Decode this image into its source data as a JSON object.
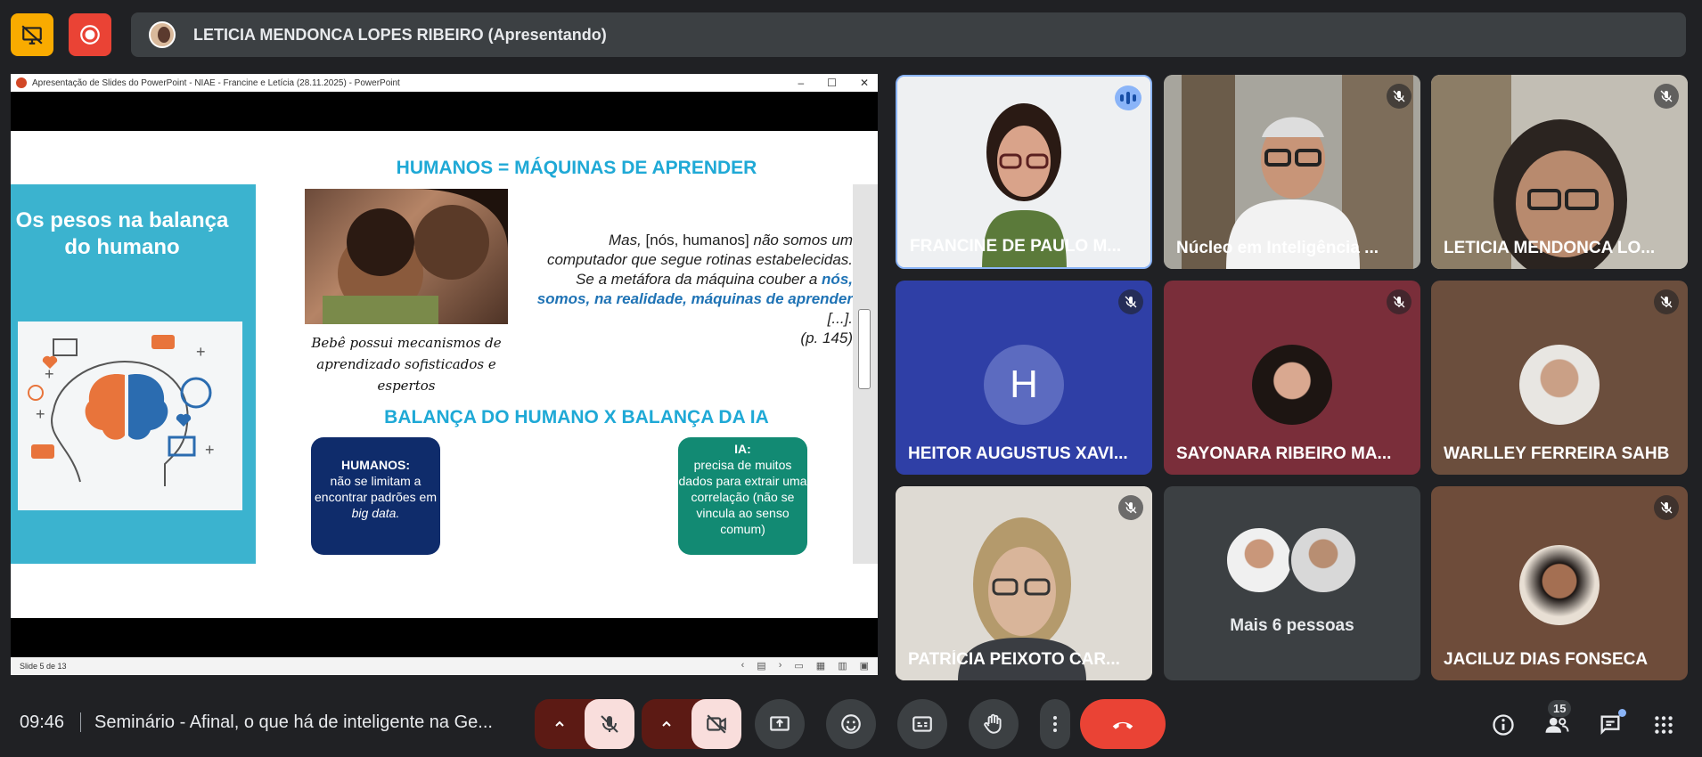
{
  "presenter": {
    "name": "LETICIA MENDONCA LOPES RIBEIRO (Apresentando)"
  },
  "powerpoint": {
    "window_title": "Apresentação de Slides do PowerPoint  -  NIAE - Francine e Letícia (28.11.2025) - PowerPoint",
    "status": "Slide 5 de 13",
    "slide": {
      "left_title": "Os pesos na balança do humano",
      "title": "HUMANOS = MÁQUINAS DE APRENDER",
      "caption": "Bebê possui mecanismos de aprendizado sofisticados e espertos",
      "quote_part1": "Mas, ",
      "quote_part2": "[nós, humanos]",
      "quote_part3": " não somos um computador que segue rotinas estabelecidas. Se a metáfora da máquina couber a ",
      "quote_bold": "nós, somos, na realidade, máquinas de aprender",
      "quote_end": " [...].",
      "quote_ref": "(p. 145)",
      "subtitle": "BALANÇA DO HUMANO X BALANÇA DA IA",
      "box_humanos_title": "HUMANOS:",
      "box_humanos_text": "não se limitam a encontrar padrões em ",
      "box_humanos_italic": "big data.",
      "box_ia_title": "IA:",
      "box_ia_text": "precisa de muitos dados para extrair uma correlação (não se vincula ao senso comum)"
    }
  },
  "participants": [
    {
      "name": "FRANCINE DE PAULO M...",
      "state": "speaking",
      "color": "#e9ecef"
    },
    {
      "name": "Núcleo em Inteligência ...",
      "state": "muted",
      "color": "#8a8f88"
    },
    {
      "name": "LETICIA MENDONCA LO...",
      "state": "muted",
      "color": "#b7b2a8"
    },
    {
      "name": "HEITOR AUGUSTUS XAVI...",
      "state": "muted",
      "avatar_letter": "H",
      "color": "#2f3fa6"
    },
    {
      "name": "SAYONARA RIBEIRO MA...",
      "state": "muted",
      "color": "#7a2e3a"
    },
    {
      "name": "WARLLEY FERREIRA SAHB",
      "state": "muted",
      "color": "#6b4e3d"
    },
    {
      "name": "PATRÍCIA PEIXOTO CAR...",
      "state": "muted",
      "color": "#c9c4bd"
    },
    {
      "name": "JACILUZ DIAS FONSECA",
      "state": "muted",
      "color": "#6e4c3a"
    }
  ],
  "more_people": "Mais 6 pessoas",
  "bottom_bar": {
    "time": "09:46",
    "meeting_title": "Seminário - Afinal, o que há de inteligente na Ge...",
    "participants_count": "15"
  },
  "colors": {
    "background": "#202124",
    "hangup": "#ea4335",
    "accent": "#8ab4f8"
  }
}
